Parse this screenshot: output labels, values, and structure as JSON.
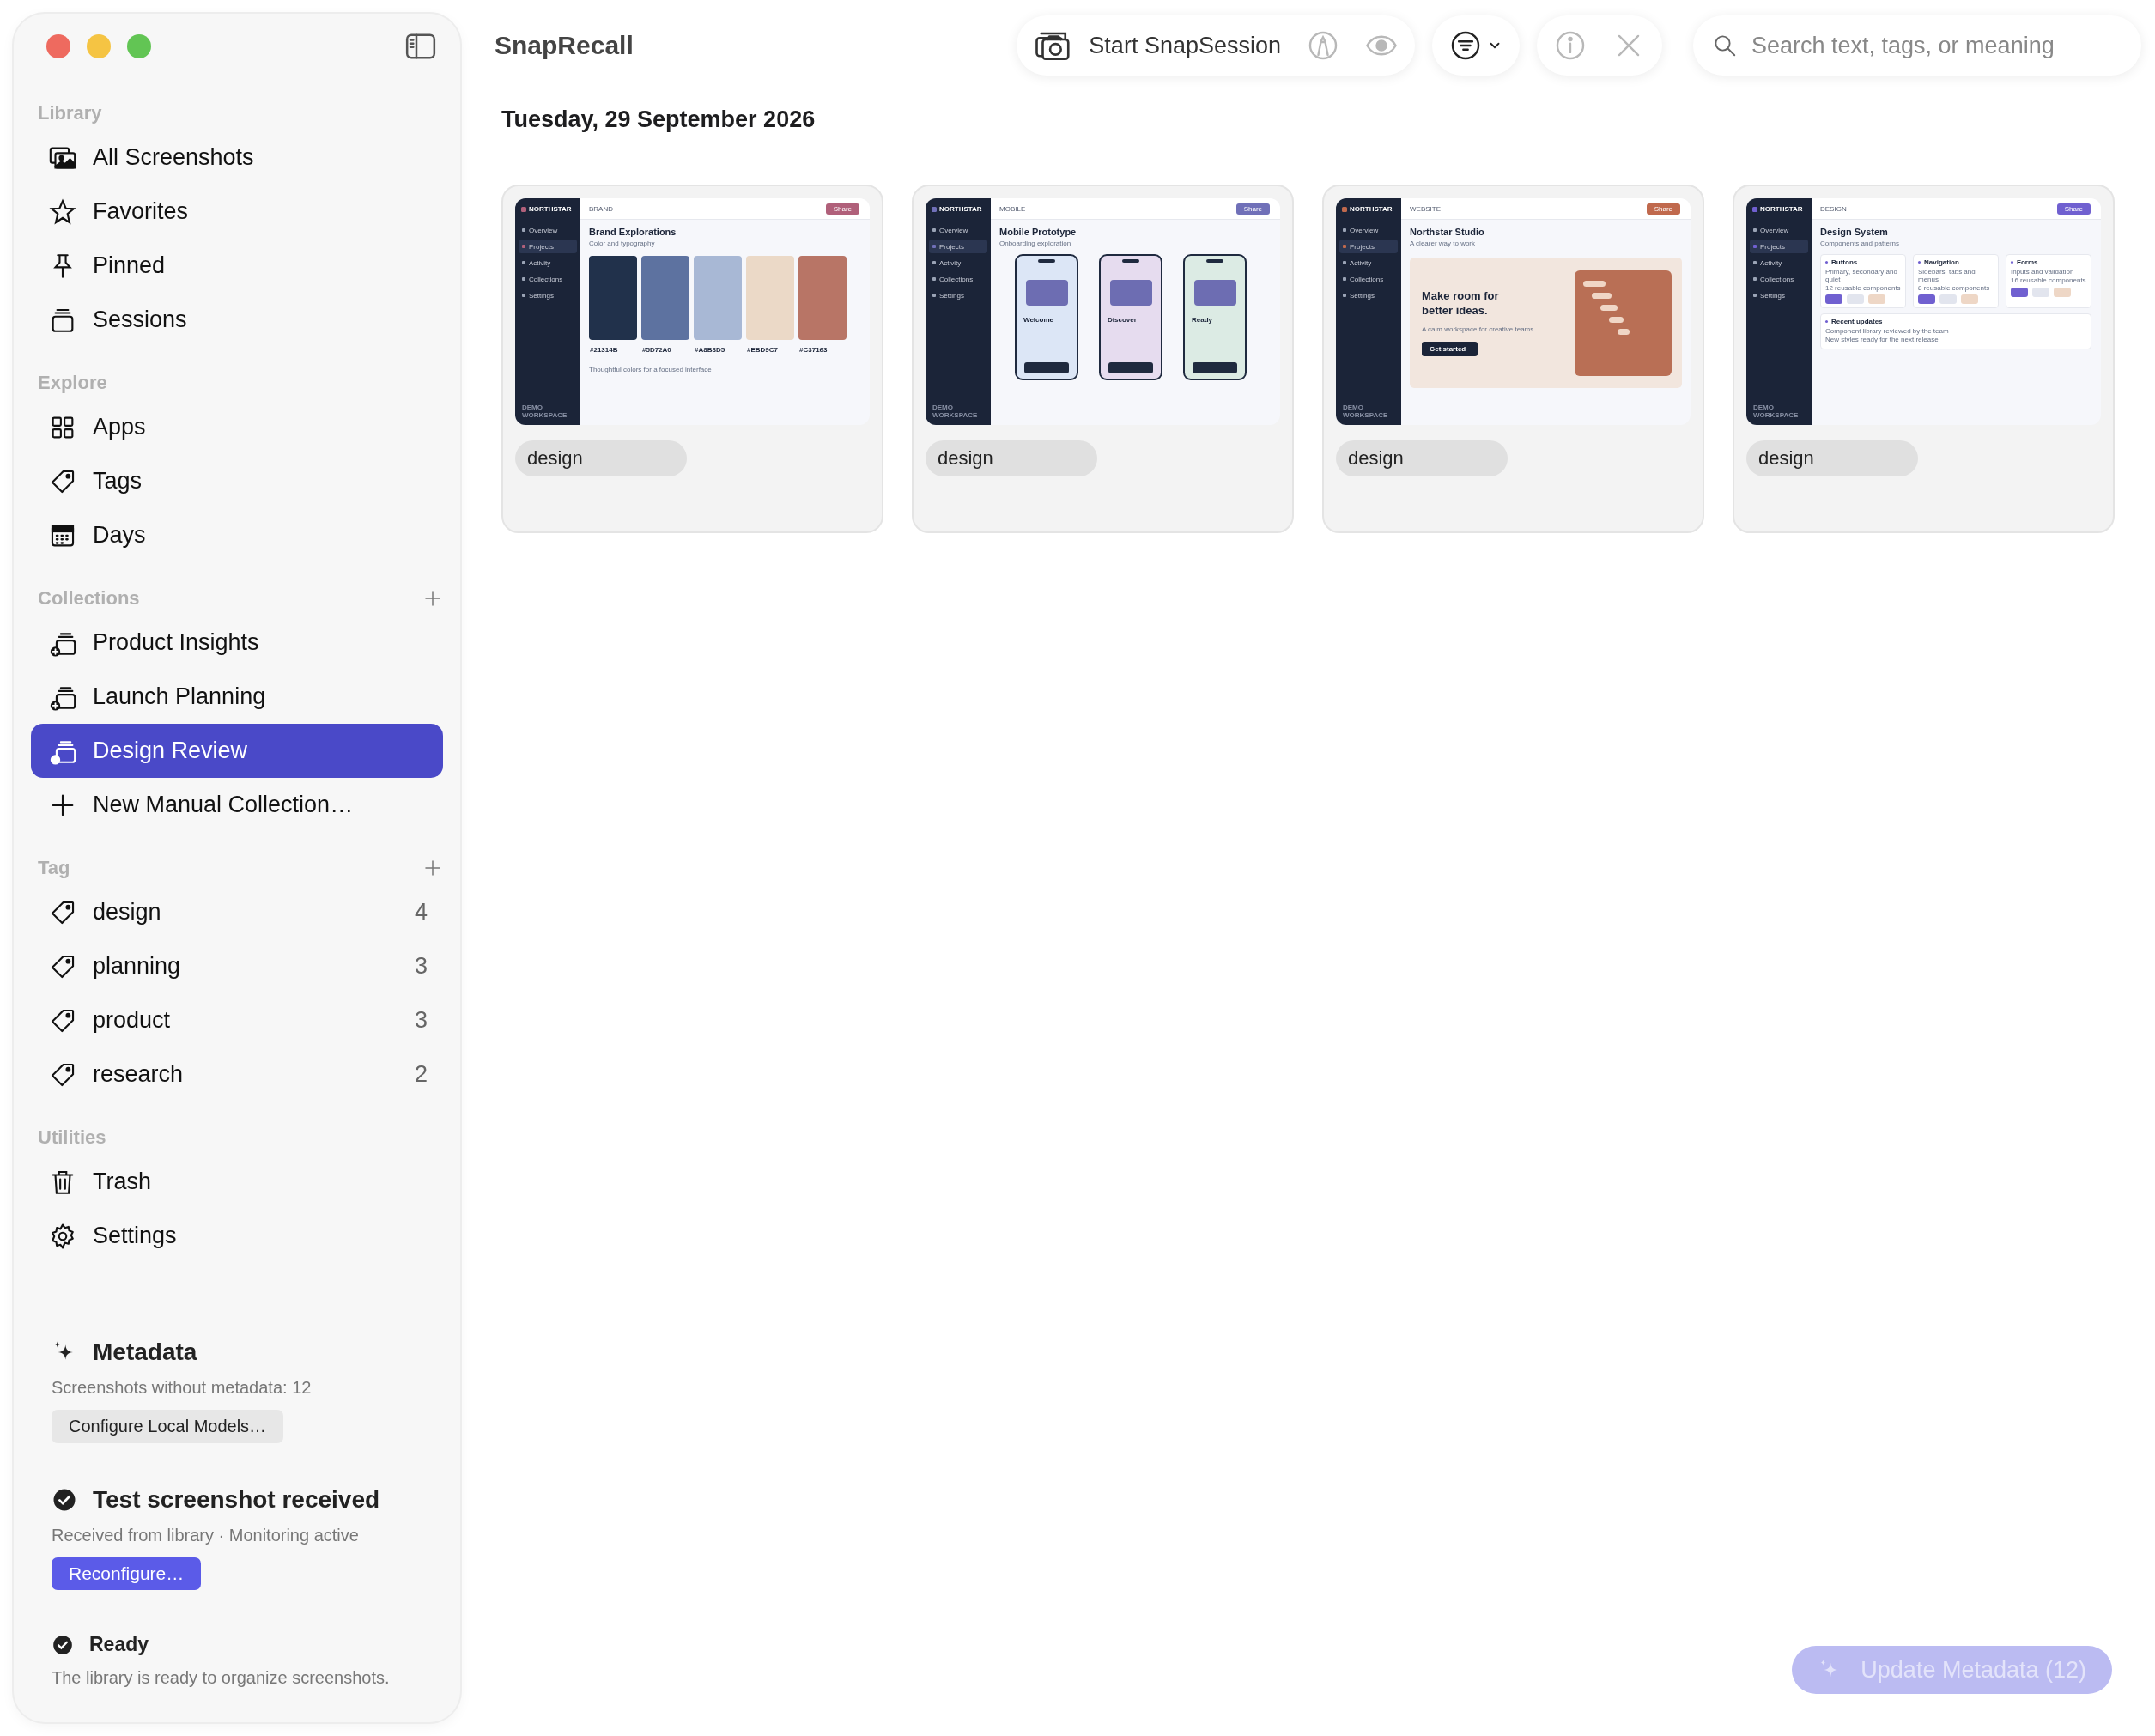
{
  "window": {
    "title": "SnapRecall"
  },
  "sidebar": {
    "sections": [
      {
        "title": "Library",
        "add": false,
        "items": [
          {
            "label": "All Screenshots",
            "kind": "photos",
            "selected": false
          },
          {
            "label": "Favorites",
            "kind": "star",
            "selected": false
          },
          {
            "label": "Pinned",
            "kind": "pin",
            "selected": false
          },
          {
            "label": "Sessions",
            "kind": "stack",
            "selected": false
          }
        ]
      },
      {
        "title": "Explore",
        "add": false,
        "items": [
          {
            "label": "Apps",
            "kind": "grid",
            "selected": false
          },
          {
            "label": "Tags",
            "kind": "tag",
            "selected": false
          },
          {
            "label": "Days",
            "kind": "calendar",
            "selected": false
          }
        ]
      },
      {
        "title": "Collections",
        "add": true,
        "items": [
          {
            "label": "Product Insights",
            "kind": "collection",
            "selected": false
          },
          {
            "label": "Launch Planning",
            "kind": "collection",
            "selected": false
          },
          {
            "label": "Design Review",
            "kind": "collection",
            "selected": true
          },
          {
            "label": "New Manual Collection…",
            "kind": "plus",
            "selected": false
          }
        ]
      },
      {
        "title": "Tag",
        "add": true,
        "items": [
          {
            "label": "design",
            "kind": "tag",
            "count": "4",
            "selected": false
          },
          {
            "label": "planning",
            "kind": "tag",
            "count": "3",
            "selected": false
          },
          {
            "label": "product",
            "kind": "tag",
            "count": "3",
            "selected": false
          },
          {
            "label": "research",
            "kind": "tag",
            "count": "2",
            "selected": false
          }
        ]
      },
      {
        "title": "Utilities",
        "add": false,
        "items": [
          {
            "label": "Trash",
            "kind": "trash",
            "selected": false
          },
          {
            "label": "Settings",
            "kind": "gear",
            "selected": false
          }
        ]
      }
    ],
    "metadata": {
      "title": "Metadata",
      "text": "Screenshots without metadata: 12",
      "button": "Configure Local Models…"
    },
    "status": {
      "title": "Test screenshot received",
      "text": "Received from library · Monitoring active",
      "button": "Reconfigure…"
    },
    "ready": {
      "title": "Ready",
      "text": "The library is ready to organize screenshots."
    }
  },
  "toolbar": {
    "session_button": "Start SnapSession",
    "tools": [
      {
        "kind": "markup",
        "disabled": true
      },
      {
        "kind": "eye",
        "disabled": true
      }
    ],
    "info": {
      "disabled": true
    },
    "close": {
      "disabled": true
    },
    "search": {
      "placeholder": "Search text, tags, or meaning"
    }
  },
  "date_heading": "Tuesday, 29 September 2026",
  "cards": [
    {
      "tag": "design",
      "preview": {
        "kind": "palette",
        "brand": "NORTHSTAR",
        "color": "#b0607a",
        "section": "BRAND",
        "share": "Share",
        "nav": [
          {
            "label": "Overview",
            "selected": false
          },
          {
            "label": "Projects",
            "selected": true
          },
          {
            "label": "Activity",
            "selected": false
          },
          {
            "label": "Collections",
            "selected": false
          },
          {
            "label": "Settings",
            "selected": false
          }
        ],
        "footer": "DEMO WORKSPACE",
        "title": "Brand Explorations",
        "subtitle": "Color and typography",
        "swatches": [
          {
            "label": "#21314B",
            "color": "#21314b"
          },
          {
            "label": "#5D72A0",
            "color": "#5d72a0"
          },
          {
            "label": "#A8B8D5",
            "color": "#a8b8d5"
          },
          {
            "label": "#EBD9C7",
            "color": "#ebd9c7"
          },
          {
            "label": "#C37163",
            "color": "#b87566"
          }
        ],
        "note": "Thoughtful colors for a focused interface"
      }
    },
    {
      "tag": "design",
      "preview": {
        "kind": "phones",
        "brand": "NORTHSTAR",
        "color": "#7070b8",
        "section": "MOBILE",
        "share": "Share",
        "nav": [
          {
            "label": "Overview",
            "selected": false
          },
          {
            "label": "Projects",
            "selected": true
          },
          {
            "label": "Activity",
            "selected": false
          },
          {
            "label": "Collections",
            "selected": false
          },
          {
            "label": "Settings",
            "selected": false
          }
        ],
        "footer": "DEMO WORKSPACE",
        "title": "Mobile Prototype",
        "subtitle": "Onboarding exploration",
        "screens": [
          {
            "label": "Welcome",
            "color": "#dce6f6"
          },
          {
            "label": "Discover",
            "color": "#e6dcef"
          },
          {
            "label": "Ready",
            "color": "#dcebe4"
          }
        ]
      }
    },
    {
      "tag": "design",
      "preview": {
        "kind": "hero",
        "brand": "NORTHSTAR",
        "color": "#c0694d",
        "section": "WEBSITE",
        "share": "Share",
        "nav": [
          {
            "label": "Overview",
            "selected": false
          },
          {
            "label": "Projects",
            "selected": true
          },
          {
            "label": "Activity",
            "selected": false
          },
          {
            "label": "Collections",
            "selected": false
          },
          {
            "label": "Settings",
            "selected": false
          }
        ],
        "footer": "DEMO WORKSPACE",
        "title": "Northstar Studio",
        "subtitle": "A clearer way to work",
        "headline": "Make room for better ideas.",
        "body": "A calm workspace for creative teams.",
        "cta": "Get started"
      }
    },
    {
      "tag": "design",
      "preview": {
        "kind": "system",
        "brand": "NORTHSTAR",
        "color": "#7060d0",
        "section": "DESIGN",
        "share": "Share",
        "nav": [
          {
            "label": "Overview",
            "selected": false
          },
          {
            "label": "Projects",
            "selected": true
          },
          {
            "label": "Activity",
            "selected": false
          },
          {
            "label": "Collections",
            "selected": false
          },
          {
            "label": "Settings",
            "selected": false
          }
        ],
        "footer": "DEMO WORKSPACE",
        "title": "Design System",
        "subtitle": "Components and patterns",
        "panels": [
          {
            "title": "Buttons",
            "lines": [
              "Primary, secondary and quiet",
              "12 reusable components"
            ]
          },
          {
            "title": "Navigation",
            "lines": [
              "Sidebars, tabs and menus",
              "8 reusable components"
            ]
          },
          {
            "title": "Forms",
            "lines": [
              "Inputs and validation",
              "16 reusable components"
            ]
          }
        ],
        "updates": {
          "title": "Recent updates",
          "lines": [
            "Component library reviewed by the team",
            "New styles ready for the next release"
          ]
        }
      }
    }
  ],
  "update_button": {
    "label": "Update Metadata (12)",
    "disabled": true
  }
}
